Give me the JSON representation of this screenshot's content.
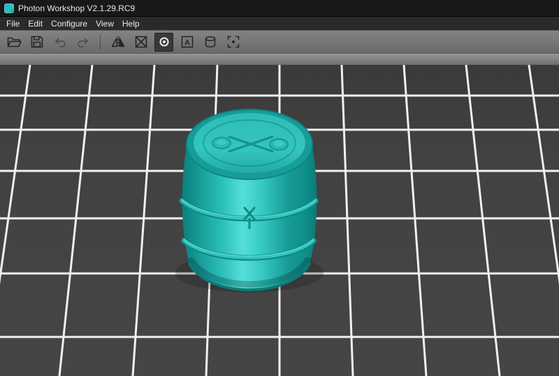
{
  "window": {
    "title": "Photon Workshop V2.1.29.RC9"
  },
  "menu": {
    "items": [
      "File",
      "Edit",
      "Configure",
      "View",
      "Help"
    ]
  },
  "toolbar": {
    "buttons": [
      {
        "name": "open",
        "icon": "folder-open-icon"
      },
      {
        "name": "save",
        "icon": "save-icon"
      },
      {
        "name": "undo",
        "icon": "undo-arrow-icon"
      },
      {
        "name": "redo",
        "icon": "redo-arrow-icon"
      },
      {
        "name": "mirror",
        "icon": "mirror-icon"
      },
      {
        "name": "arrange",
        "icon": "box-cross-icon"
      },
      {
        "name": "view",
        "icon": "circle-dot-icon",
        "active": true
      },
      {
        "name": "text",
        "icon": "letter-a-icon"
      },
      {
        "name": "resin",
        "icon": "cylinder-icon"
      },
      {
        "name": "plate",
        "icon": "frame-target-icon"
      }
    ],
    "text_tool_glyph": "A"
  },
  "viewport": {
    "model": {
      "name": "oil-barrel",
      "color": "#29b8b2"
    },
    "grid_color": "#f0f0f0",
    "background": "#414141"
  },
  "colors": {
    "titlebar": "#181818",
    "menubar": "#2a2a2a",
    "toolbar": "#787878",
    "model_teal": "#29b8b2",
    "model_teal_dark": "#0f8c88",
    "model_teal_light": "#55ded8"
  }
}
